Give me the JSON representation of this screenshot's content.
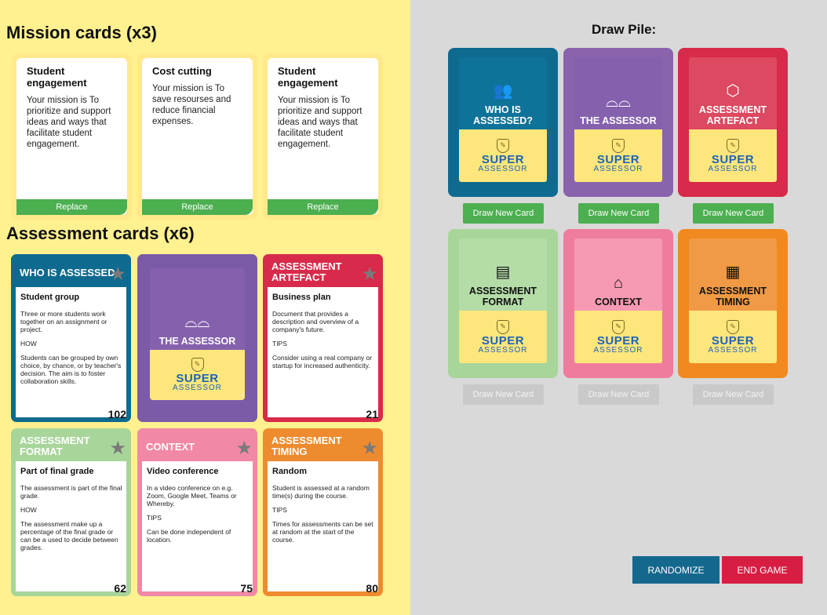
{
  "mission_title": "Mission cards (x3)",
  "assessment_title": "Assessment cards (x6)",
  "draw_pile_title": "Draw Pile:",
  "mission_cards": [
    {
      "title": "Student engagement",
      "text": "Your mission is To prioritize and support ideas and ways that facilitate student engagement.",
      "button": "Replace"
    },
    {
      "title": "Cost cutting",
      "text": "Your mission is To save resourses and reduce financial expenses.",
      "button": "Replace"
    },
    {
      "title": "Student engagement",
      "text": "Your mission is To prioritize and support ideas and ways that facilitate student engagement.",
      "button": "Replace"
    }
  ],
  "assessment_cards": [
    {
      "category": "WHO IS ASSESSED",
      "title": "Student group",
      "desc": "Three or more students work together on an assignment or project.",
      "label": "HOW",
      "detail": "Students can be grouped by own choice, by chance, or by teacher's decision. The aim is to foster collaboration skills.",
      "number": "102",
      "color": "#0e6a8f"
    },
    {
      "category": "THE ASSESSOR",
      "face_down": true,
      "color": "#7b5ba8"
    },
    {
      "category": "ASSESSMENT ARTEFACT",
      "title": "Business plan",
      "desc": "Document that provides a description and overview of a company's future.",
      "label": "TIPS",
      "detail": "Consider using a real company or startup for increased authenticity.",
      "number": "21",
      "color": "#d82a4a"
    },
    {
      "category": "ASSESSMENT FORMAT",
      "title": "Part of final grade",
      "desc": "The assessment is part of the final grade.",
      "label": "HOW",
      "detail": "The assessment make up a percentage of the final grade or can be a used to decide between grades.",
      "number": "62",
      "color": "#a8d59a"
    },
    {
      "category": "CONTEXT",
      "title": "Video conference",
      "desc": "In a video conference on e.g. Zoom, Google Meet, Teams or Whereby.",
      "label": "TIPS",
      "detail": "Can be done independent of location.",
      "number": "75",
      "color": "#f189a6"
    },
    {
      "category": "ASSESSMENT TIMING",
      "title": "Random",
      "desc": "Student is assessed at a random time(s) during the course.",
      "label": "TIPS",
      "detail": "Times for assessments can be set at random at the start of the course.",
      "number": "80",
      "color": "#ee8b2e"
    }
  ],
  "draw_pile": [
    {
      "title": "WHO IS ASSESSED?",
      "icon": "people-icon",
      "button": "Draw New Card",
      "enabled": true,
      "frame": "#0e6a8f",
      "art": "#0f7399"
    },
    {
      "title": "THE ASSESSOR",
      "icon": "glasses-icon",
      "button": "Draw New Card",
      "enabled": true,
      "frame": "#8a63ad",
      "art": "#8561ad"
    },
    {
      "title": "ASSESSMENT ARTEFACT",
      "icon": "box-icon",
      "button": "Draw New Card",
      "enabled": true,
      "frame": "#d82a4a",
      "art": "#dc4960"
    },
    {
      "title": "ASSESSMENT FORMAT",
      "icon": "document-icon",
      "button": "Draw New Card",
      "enabled": false,
      "frame": "#a8d59a",
      "art": "#b4dca7"
    },
    {
      "title": "CONTEXT",
      "icon": "school-icon",
      "button": "Draw New Card",
      "enabled": false,
      "frame": "#f07c9d",
      "art": "#f59ab2"
    },
    {
      "title": "ASSESSMENT TIMING",
      "icon": "calendar-icon",
      "button": "Draw New Card",
      "enabled": false,
      "frame": "#f0891f",
      "art": "#f19a45"
    }
  ],
  "brand": {
    "super": "SUPER",
    "assessor": "ASSESSOR"
  },
  "buttons": {
    "randomize": "RANDOMIZE",
    "end_game": "END GAME"
  },
  "colors": {
    "green": "#4caf50",
    "randomize": "#14688e",
    "end_game": "#d81d43"
  }
}
